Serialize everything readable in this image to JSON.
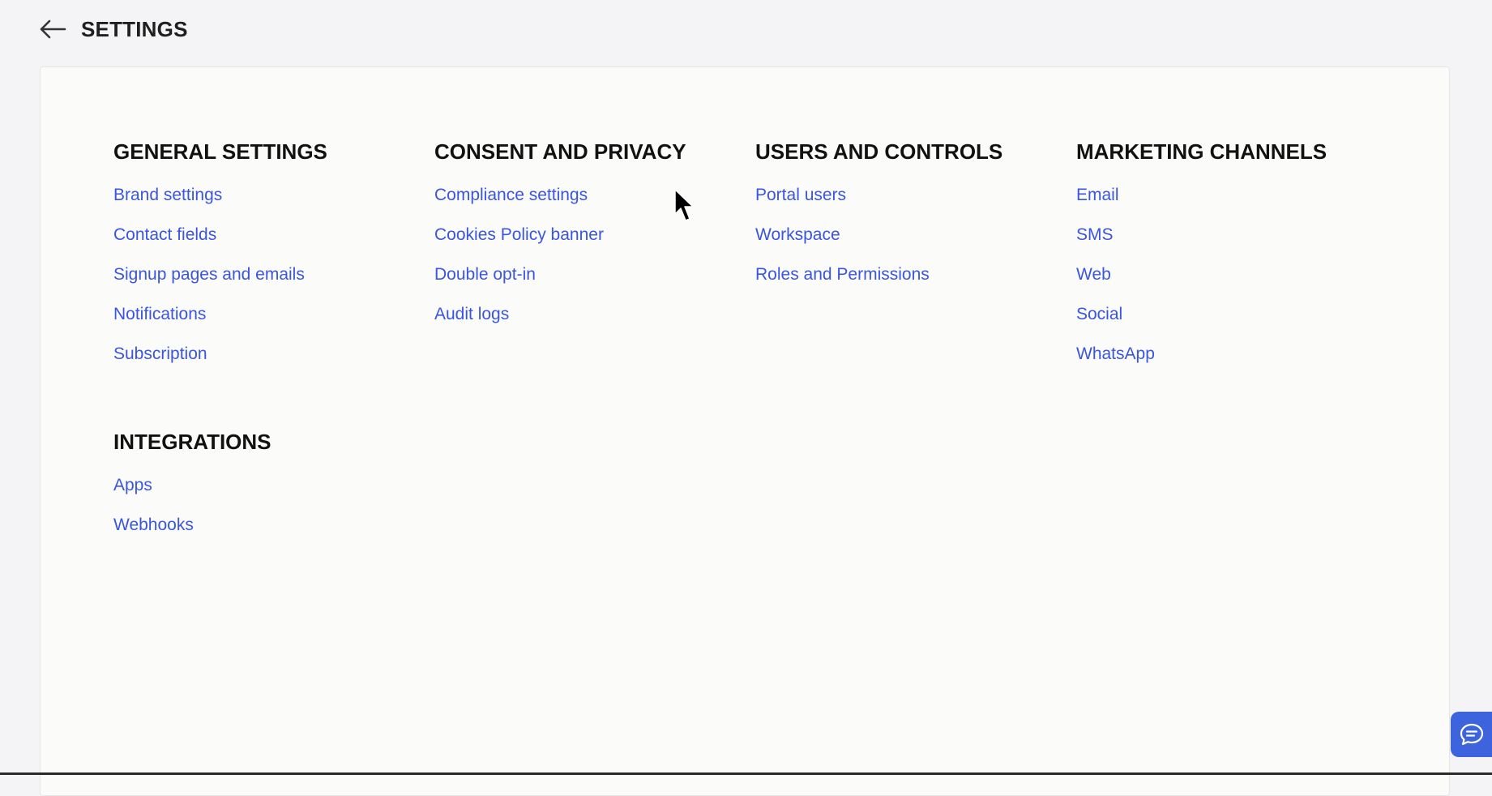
{
  "header": {
    "title": "SETTINGS",
    "back_icon": "arrow-left-icon"
  },
  "sections": [
    {
      "title": "GENERAL SETTINGS",
      "items": [
        "Brand settings",
        "Contact fields",
        "Signup pages and emails",
        "Notifications",
        "Subscription"
      ]
    },
    {
      "title": "CONSENT AND PRIVACY",
      "items": [
        "Compliance settings",
        "Cookies Policy banner",
        "Double opt-in",
        "Audit logs"
      ]
    },
    {
      "title": "USERS AND CONTROLS",
      "items": [
        "Portal users",
        "Workspace",
        "Roles and Permissions"
      ]
    },
    {
      "title": "MARKETING CHANNELS",
      "items": [
        "Email",
        "SMS",
        "Web",
        "Social",
        "WhatsApp"
      ]
    },
    {
      "title": "INTEGRATIONS",
      "items": [
        "Apps",
        "Webhooks"
      ]
    }
  ],
  "chat_widget": {
    "icon": "chat-bubble-icon",
    "color": "#3d63dd"
  },
  "colors": {
    "link": "#3a55e0",
    "heading": "#111111",
    "background": "#f4f4f6",
    "card": "#fbfbfa"
  }
}
